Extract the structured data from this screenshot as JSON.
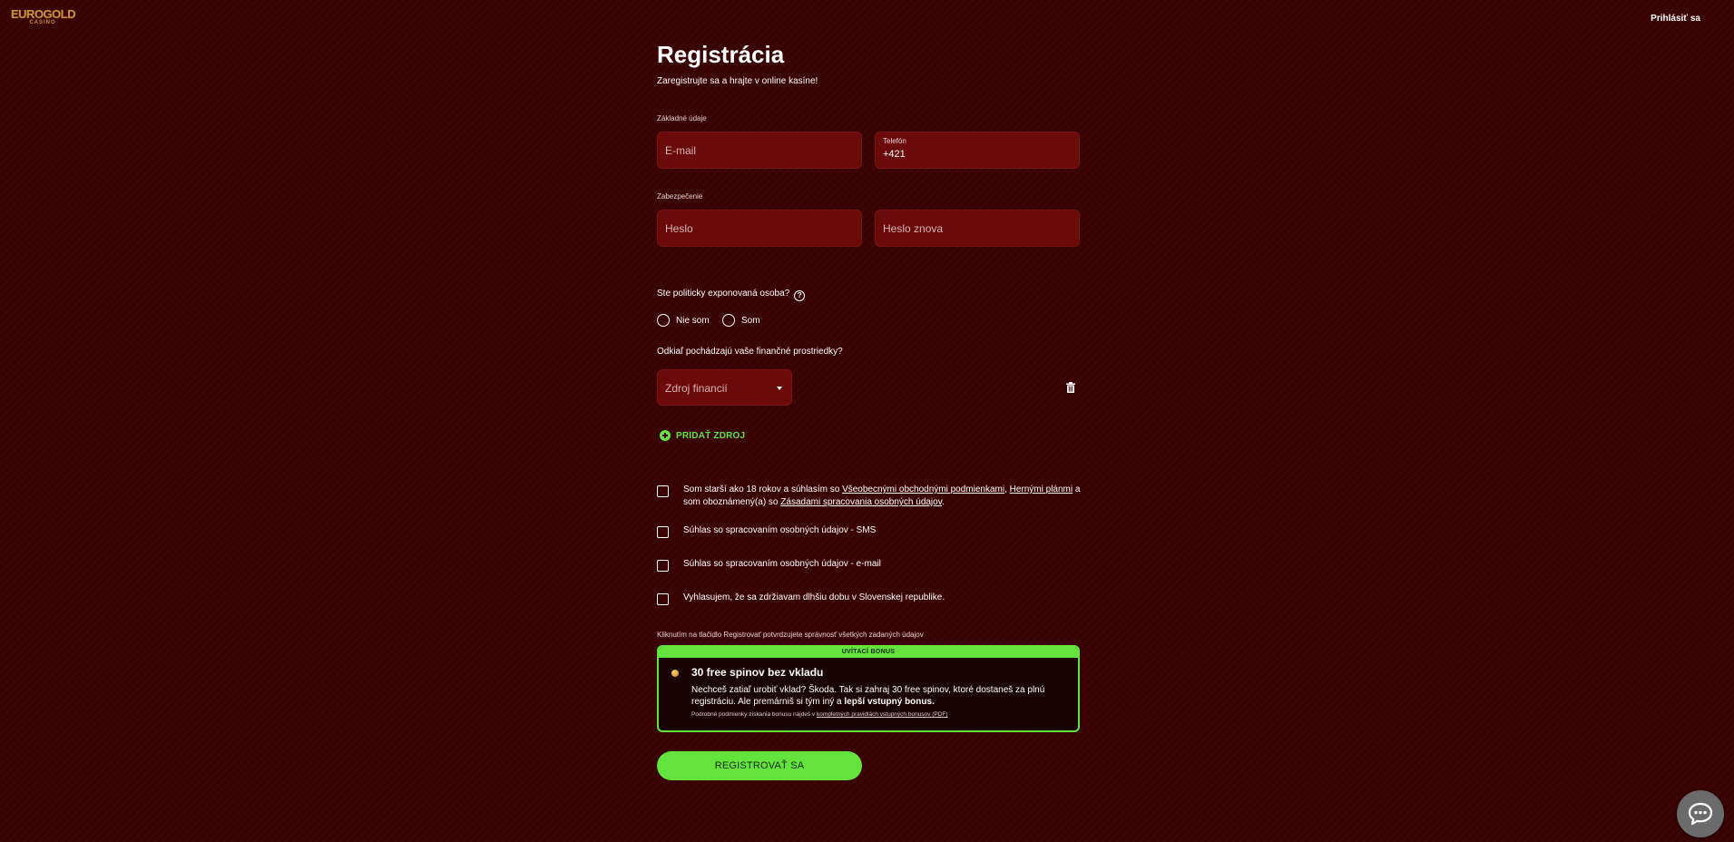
{
  "header": {
    "logo_main": "EUROGOLD",
    "logo_sub": "CASINO",
    "login": "Prihlásiť sa"
  },
  "form": {
    "title": "Registrácia",
    "subtitle": "Zaregistrujte sa a hrajte v online kasíne!",
    "basic_section": "Základné údaje",
    "email_placeholder": "E-mail",
    "phone_label": "Telefón",
    "phone_prefix": "+421",
    "security_section": "Zabezpečenie",
    "password_placeholder": "Heslo",
    "password_repeat_placeholder": "Heslo znova",
    "pep_question": "Ste politicky exponovaná osoba?",
    "pep_help_icon": "question-circle-icon",
    "pep_options": [
      "Nie som",
      "Som"
    ],
    "funds_question": "Odkiaľ pochádzajú vaše finančné prostriedky?",
    "funds_select_placeholder": "Zdroj financií",
    "add_source": "PRIDAŤ ZDROJ"
  },
  "consents": {
    "terms": {
      "prefix": "Som starší ako 18 rokov a súhlasím so ",
      "link1": "Všeobecnými obchodnými podmienkami",
      "sep1": ", ",
      "link2": "Hernými plánmi",
      "middle": " a som oboznámený(a) so ",
      "link3": "Zásadami spracovania osobných údajov",
      "suffix": "."
    },
    "sms": "Súhlas so spracovaním osobných údajov - SMS",
    "email": "Súhlas so spracovaním osobných údajov - e-mail",
    "residency": "Vyhlasujem, že sa zdržiavam dlhšiu dobu v Slovenskej republike."
  },
  "confirm_note": "Kliknutím na tlačidlo Registrovať potvrdzujete správnosť všetkých zadaných údajov",
  "bonus": {
    "header": "UVÍTACÍ BONUS",
    "title": "30 free spinov bez vkladu",
    "desc_part1": "Nechceš zatiaľ urobiť vklad? Škoda. Tak si zahraj 30 free spinov, ktoré dostaneš za plnú registráciu. Ale premárniš si tým iný a ",
    "desc_bold": "lepší vstupný bonus.",
    "fine_prefix": "Podrobné podmienky získania bonusu nájdeš v ",
    "fine_link": "kompletných pravidlách vstupných bonusov (PDF)"
  },
  "register_button": "REGISTROVAŤ SA",
  "colors": {
    "background": "#3a0202",
    "field": "#6a0a0a",
    "accent_green": "#63e33b",
    "logo_gold": "#c9913e"
  }
}
